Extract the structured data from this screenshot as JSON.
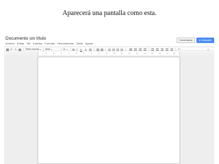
{
  "caption": "Aparecerá una pantalla como esta.",
  "document": {
    "title": "Documento sin título"
  },
  "menu": [
    "Archivo",
    "Editar",
    "Ver",
    "Insertar",
    "Formato",
    "Herramientas",
    "Tabla",
    "Ayuda"
  ],
  "buttons": {
    "comments": "Comentarios",
    "share": "Compartir"
  },
  "toolbar": {
    "style_select": "Texto normal",
    "font_select": "Arial",
    "size_select": "11"
  },
  "ruler": {
    "numbers": [
      "1",
      "2",
      "3",
      "4",
      "5",
      "6",
      "7",
      "8",
      "9",
      "10",
      "11",
      "12",
      "13",
      "14",
      "15",
      "16",
      "17",
      "18"
    ]
  },
  "colors": {
    "share_button": "#4a8af4",
    "workspace": "#eeeeee"
  }
}
